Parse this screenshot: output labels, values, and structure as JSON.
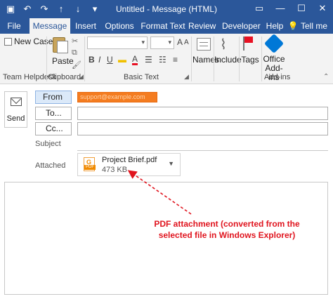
{
  "window": {
    "title": "Untitled  -  Message (HTML)",
    "qat_icons": [
      "save-icon",
      "undo-icon",
      "redo-icon",
      "up-arrow-icon",
      "down-arrow-icon",
      "customize-qat-icon"
    ],
    "controls": [
      "ribbon-display-icon",
      "minimize-icon",
      "maximize-icon",
      "close-icon"
    ]
  },
  "tabs": [
    {
      "label": "File"
    },
    {
      "label": "Message",
      "active": true
    },
    {
      "label": "Insert"
    },
    {
      "label": "Options"
    },
    {
      "label": "Format Text"
    },
    {
      "label": "Review"
    },
    {
      "label": "Developer"
    },
    {
      "label": "Help"
    }
  ],
  "tell_me": "Tell me",
  "ribbon": {
    "new_case": "New Case",
    "group_team_helpdesk": "Team Helpdesk",
    "paste": "Paste",
    "group_clipboard": "Clipboard",
    "group_basic_text": "Basic Text",
    "names": "Names",
    "include": "Include",
    "tags": "Tags",
    "office_addins": "Office\nAdd-ins",
    "office_addins_line1": "Office",
    "office_addins_line2": "Add-ins",
    "group_addins": "Add-ins"
  },
  "compose": {
    "send": "Send",
    "from": "From",
    "from_value": "support@example.com",
    "to": "To...",
    "cc": "Cc...",
    "subject_label": "Subject",
    "attached_label": "Attached",
    "attachment": {
      "name": "Project Brief.pdf",
      "size": "473 KB",
      "icon_letter": "G",
      "icon_text": "PDF"
    }
  },
  "annotation": {
    "line1": "PDF attachment (converted from the",
    "line2": "selected file in Windows Explorer)"
  },
  "colors": {
    "accent": "#2b579a",
    "annotation": "#e0141e",
    "redaction": "#f47c20"
  }
}
